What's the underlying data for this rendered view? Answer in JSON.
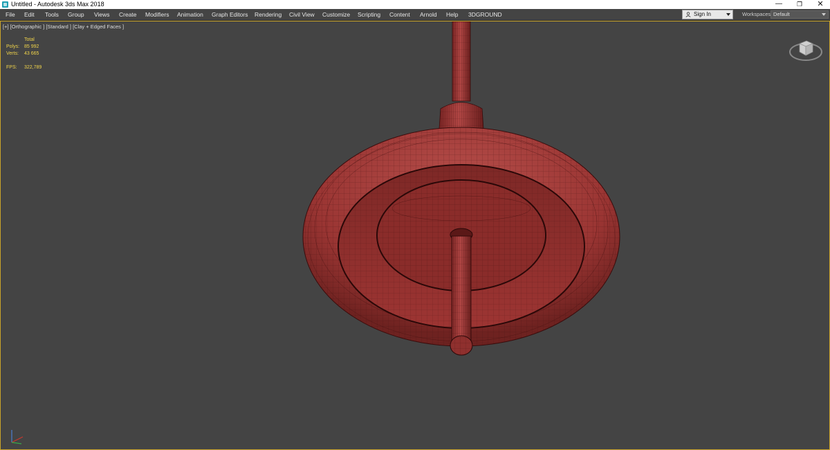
{
  "window": {
    "title": "Untitled - Autodesk 3ds Max 2018",
    "controls": {
      "minimize": "—",
      "maximize": "❐",
      "close": "✕"
    }
  },
  "menubar": {
    "items": [
      "File",
      "Edit",
      "Tools",
      "Group",
      "Views",
      "Create",
      "Modifiers",
      "Animation",
      "Graph Editors",
      "Rendering",
      "Civil View",
      "Customize",
      "Scripting",
      "Content",
      "Arnold",
      "Help",
      "3DGROUND"
    ],
    "signin_label": "Sign In",
    "workspaces_label": "Workspaces:",
    "workspaces_value": "Default"
  },
  "viewport": {
    "label": "[+] [Orthographic ] [Standard ] [Clay + Edged Faces ]",
    "stats": {
      "header": "Total",
      "polys_label": "Polys:",
      "polys_value": "85 992",
      "verts_label": "Verts:",
      "verts_value": "43 665",
      "fps_label": "FPS:",
      "fps_value": "322,789"
    },
    "colors": {
      "background": "#444444",
      "clay": "#a13a38",
      "wire": "#3a0c0c",
      "active_border": "#c9a42a",
      "stats_text": "#f0d34a"
    },
    "icons": [
      "viewcube-icon",
      "axis-tripod-icon"
    ]
  }
}
